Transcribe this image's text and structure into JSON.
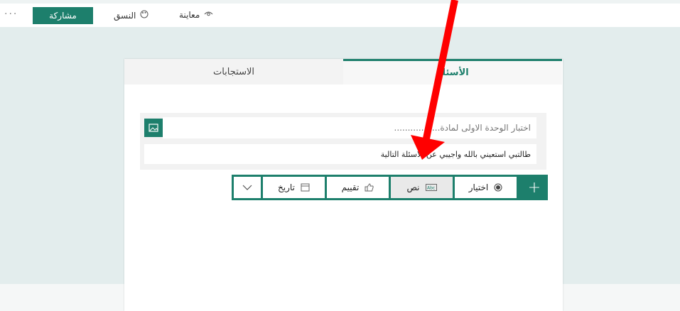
{
  "topbar": {
    "more_label": "···",
    "share_label": "مشاركة",
    "theme_label": "النسق",
    "preview_label": "معاينة"
  },
  "tabs": {
    "responses_label": "الاستجابات",
    "questions_label": "الأسئلة"
  },
  "question": {
    "title_value": "اختبار الوحدة الاولى لمادة.................",
    "description_value": "طالتبي استعيني بالله واجيبي عن الاسئلة التالية"
  },
  "toolbar": {
    "choice_label": "اختيار",
    "text_label": "نص",
    "rating_label": "تقييم",
    "date_label": "تاريخ",
    "selected": "text",
    "accent": "#1d7f6c"
  },
  "annotation": {
    "arrow_color": "#ff0000"
  }
}
